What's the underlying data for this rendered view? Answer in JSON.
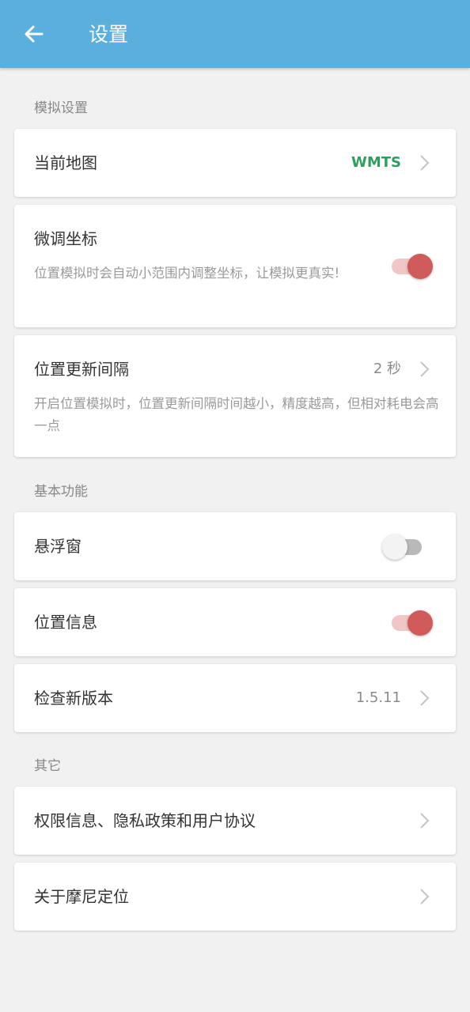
{
  "appbar": {
    "title": "设置",
    "back_icon": "arrow-left-icon"
  },
  "colors": {
    "appbar": "#5aafdc",
    "accent_green": "#2e9d5f",
    "switch_on": "#d15a5a"
  },
  "sections": {
    "simulation": {
      "header": "模拟设置",
      "current_map": {
        "label": "当前地图",
        "value": "WMTS"
      },
      "fine_tune": {
        "label": "微调坐标",
        "desc": "位置模拟时会自动小范围内调整坐标，让模拟更真实!",
        "enabled": true
      },
      "update_interval": {
        "label": "位置更新间隔",
        "value": "2 秒",
        "desc": "开启位置模拟时，位置更新间隔时间越小，精度越高，但相对耗电会高一点"
      }
    },
    "basic": {
      "header": "基本功能",
      "floating_window": {
        "label": "悬浮窗",
        "enabled": false
      },
      "location_info": {
        "label": "位置信息",
        "enabled": true
      },
      "check_update": {
        "label": "检查新版本",
        "value": "1.5.11"
      }
    },
    "other": {
      "header": "其它",
      "permissions": {
        "label": "权限信息、隐私政策和用户协议"
      },
      "about": {
        "label": "关于摩尼定位"
      }
    }
  }
}
